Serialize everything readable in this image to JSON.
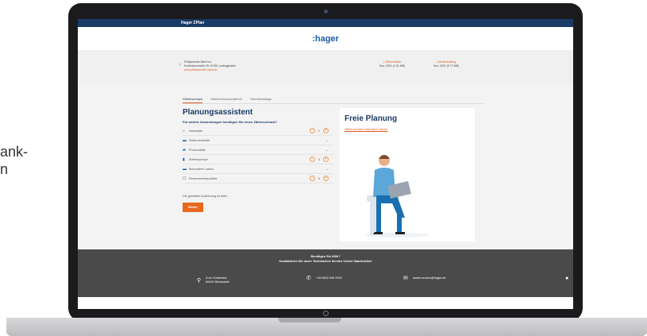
{
  "side_text": [
    "ank-",
    "n"
  ],
  "app": {
    "title": "Hager ZPlan",
    "logo": ":hager"
  },
  "dealer": {
    "name": "Philipswerke Merk Inc.",
    "address": "Kurfürstenstraße 28, 67061 Ludwigshafen",
    "link": "www.philipswerke-merk.de"
  },
  "downloads": [
    {
      "label": "Zählerstation",
      "meta": "Nov. 2021 (1.01 MB)"
    },
    {
      "label": "Musterkatalog",
      "meta": "Nov. 2021 (5.71 MB)"
    }
  ],
  "tabs": [
    "Zählerschrank",
    "Zählerschrankzubehör",
    "Überblickslisge"
  ],
  "planner": {
    "title": "Planungsassistent",
    "question": "Für welche Anwendungen benötigen Sie einen Zählerschrank?",
    "rows": [
      {
        "icon": "house-icon",
        "label": "Haushalte",
        "value": "1",
        "control": "stepper"
      },
      {
        "icon": "car-icon",
        "label": "Elektromobilität",
        "value": "",
        "control": "expand"
      },
      {
        "icon": "solar-icon",
        "label": "Photovoltaik",
        "value": "",
        "control": "expand"
      },
      {
        "icon": "heatpump-icon",
        "label": "Wärmepumpe",
        "value": "0",
        "control": "stepper"
      },
      {
        "icon": "car-icon",
        "label": "Besondere Lasten",
        "value": "",
        "control": "expand"
      },
      {
        "icon": "box-icon",
        "label": "Reserveeinbauplätze",
        "value": "0",
        "control": "stepper"
      }
    ],
    "note": "Die gewählte Ausführung ist aktiv.",
    "button": "Weiter"
  },
  "free": {
    "title": "Freie Planung",
    "link": "Zählerschrank individuell planen"
  },
  "footer": {
    "help_title": "Benötigen Sie Hilfe?",
    "help_sub": "Kontaktieren Sie unser Technisches Service Center Saarbrücken",
    "address1": "Zum Gunterstal",
    "address2": "66440 Blieskastel",
    "phone": "+49 6842 945 2900",
    "email": "saarbruecken@hager.de"
  },
  "colors": {
    "accent": "#e8681f",
    "brand": "#1a3a66",
    "footer": "#4a4a4a"
  }
}
